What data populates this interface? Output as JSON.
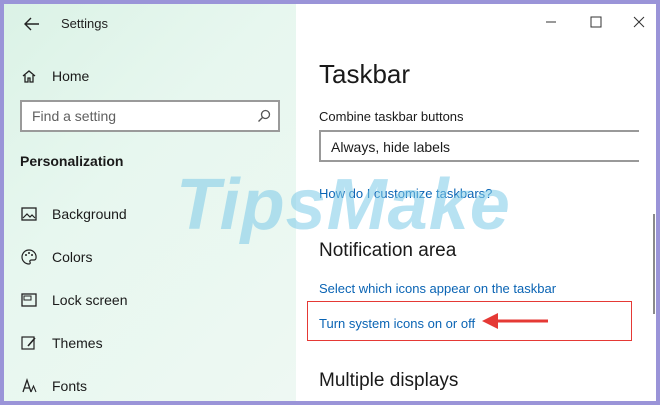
{
  "window": {
    "title": "Settings",
    "controls": {
      "minimize": "minimize",
      "maximize": "maximize",
      "close": "close"
    }
  },
  "sidebar": {
    "home_label": "Home",
    "search_placeholder": "Find a setting",
    "section_title": "Personalization",
    "items": [
      {
        "label": "Background",
        "icon": "picture-icon"
      },
      {
        "label": "Colors",
        "icon": "palette-icon"
      },
      {
        "label": "Lock screen",
        "icon": "lock-screen-icon"
      },
      {
        "label": "Themes",
        "icon": "brush-icon"
      },
      {
        "label": "Fonts",
        "icon": "font-icon"
      }
    ]
  },
  "main": {
    "title": "Taskbar",
    "combine_label": "Combine taskbar buttons",
    "combine_value": "Always, hide labels",
    "customize_link": "How do I customize taskbars?",
    "notification_heading": "Notification area",
    "select_icons_link": "Select which icons appear on the taskbar",
    "system_icons_link": "Turn system icons on or off",
    "multiple_displays_heading": "Multiple displays"
  },
  "watermark": "TipsMake",
  "colors": {
    "link": "#0a64b4",
    "highlight": "#e53935",
    "frame": "#9a94d8"
  }
}
